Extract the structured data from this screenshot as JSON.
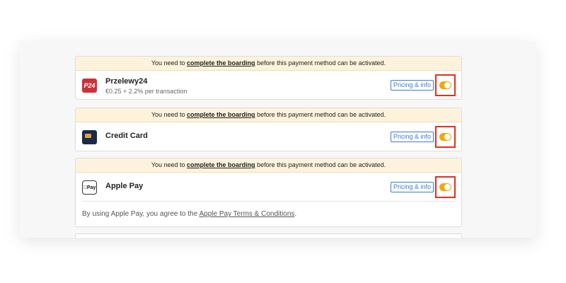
{
  "methods": [
    {
      "notice_prefix": "You need to",
      "notice_link": "complete the boarding",
      "notice_suffix": "before this payment method can be activated.",
      "logo_text": "P24",
      "logo_icon": "przelewy24-logo-icon",
      "name": "Przelewy24",
      "fee": "€0.25 + 2.2% per transaction",
      "pricing_label": "Pricing & info",
      "toggle_on": true
    },
    {
      "notice_prefix": "You need to",
      "notice_link": "complete the boarding",
      "notice_suffix": "before this payment method can be activated.",
      "logo_icon": "credit-card-icon",
      "name": "Credit Card",
      "pricing_label": "Pricing & info",
      "toggle_on": true
    },
    {
      "notice_prefix": "You need to",
      "notice_link": "complete the boarding",
      "notice_suffix": "before this payment method can be activated.",
      "logo_text": "Pay",
      "logo_icon": "apple-pay-logo-icon",
      "name": "Apple Pay",
      "pricing_label": "Pricing & info",
      "toggle_on": true,
      "terms_prefix": "By using Apple Pay, you agree to the",
      "terms_link": "Apple Pay Terms & Conditions",
      "terms_suffix": "."
    }
  ],
  "colors": {
    "notice_bg": "#fdf3dc",
    "toggle_on": "#f2a900",
    "highlight_border": "#e3301c",
    "link_blue": "#3d7bd9",
    "p24_red": "#cc3138"
  }
}
